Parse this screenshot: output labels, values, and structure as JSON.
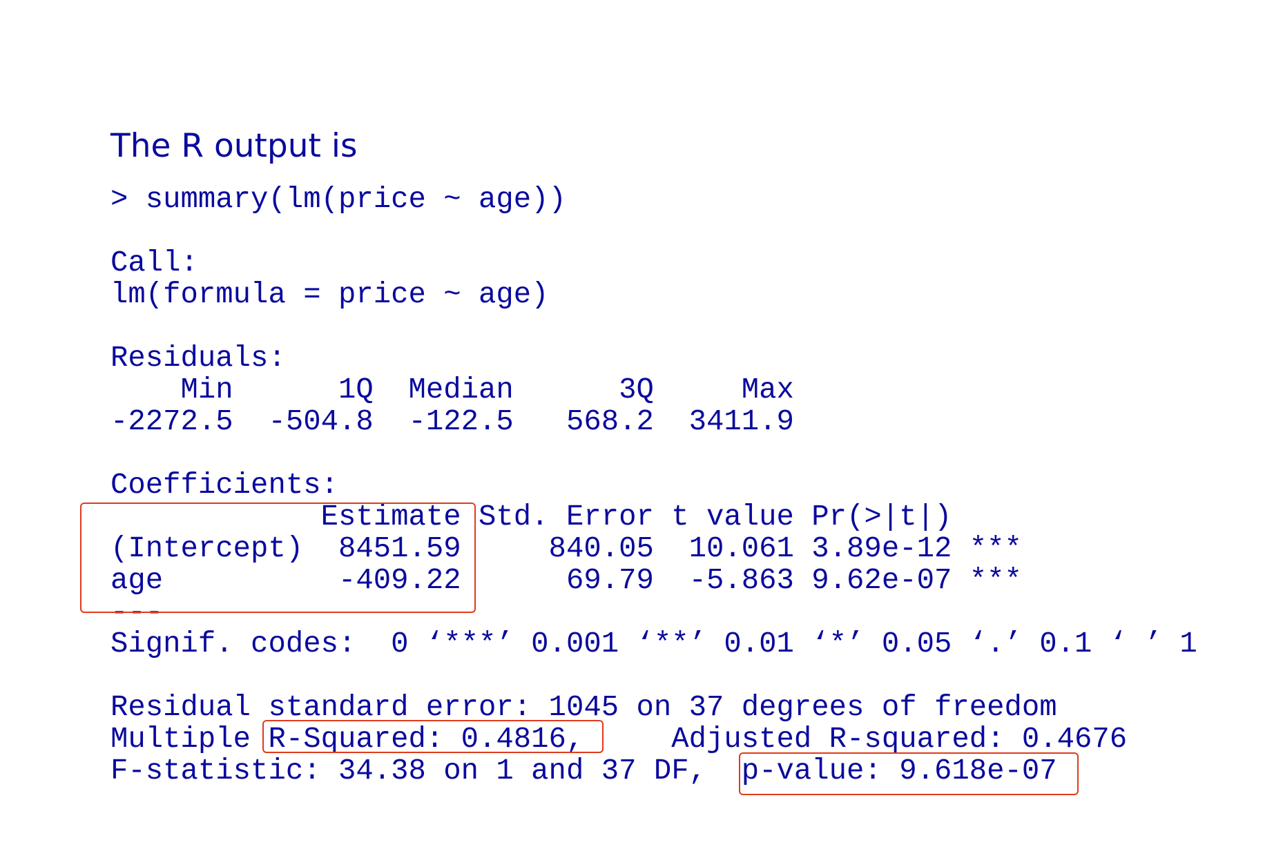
{
  "heading": "The R output is",
  "console": {
    "lines": [
      "> summary(lm(price ~ age))",
      "",
      "Call:",
      "lm(formula = price ~ age)",
      "",
      "Residuals:",
      "    Min      1Q  Median      3Q     Max",
      "-2272.5  -504.8  -122.5   568.2  3411.9",
      "",
      "Coefficients:",
      "            Estimate Std. Error t value Pr(>|t|)",
      "(Intercept)  8451.59     840.05  10.061 3.89e-12 ***",
      "age          -409.22      69.79  -5.863 9.62e-07 ***",
      "---",
      "Signif. codes:  0 ‘***’ 0.001 ‘**’ 0.01 ‘*’ 0.05 ‘.’ 0.1 ‘ ’ 1",
      "",
      "Residual standard error: 1045 on 37 degrees of freedom",
      "Multiple R-Squared: 0.4816,     Adjusted R-squared: 0.4676",
      "F-statistic: 34.38 on 1 and 37 DF,  p-value: 9.618e-07"
    ]
  },
  "highlight_color": "#e03a1c",
  "text_color": "#0a0a9e"
}
